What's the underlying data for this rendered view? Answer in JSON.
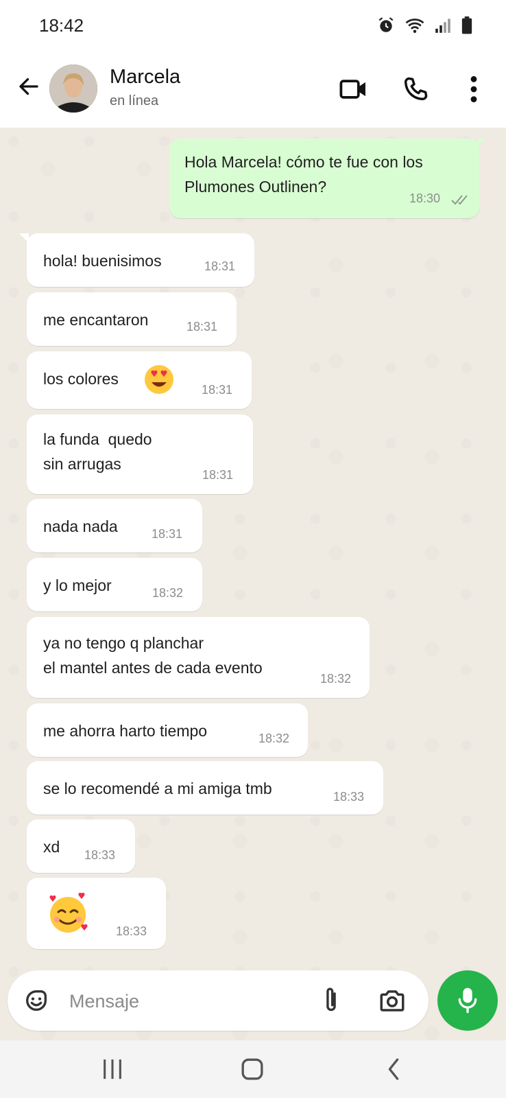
{
  "status_bar": {
    "time": "18:42",
    "icons": [
      "alarm-icon",
      "wifi-icon",
      "signal-icon",
      "battery-icon"
    ]
  },
  "header": {
    "contact_name": "Marcela",
    "contact_status": "en línea",
    "icons": [
      "back-arrow-icon",
      "video-call-icon",
      "phone-icon",
      "more-vert-icon"
    ]
  },
  "messages": [
    {
      "direction": "outgoing",
      "text": "Hola Marcela! cómo te fue con los\nPlumones Outlinen?",
      "time": "18:30",
      "status": "read"
    },
    {
      "direction": "incoming",
      "text": "hola! buenisimos",
      "time": "18:31"
    },
    {
      "direction": "incoming",
      "text": "me encantaron",
      "time": "18:31"
    },
    {
      "direction": "incoming",
      "text": "los colores",
      "emoji": "heart-eyes-emoji",
      "time": "18:31"
    },
    {
      "direction": "incoming",
      "text": "la funda  quedo\nsin arrugas",
      "time": "18:31"
    },
    {
      "direction": "incoming",
      "text": "nada nada",
      "time": "18:31"
    },
    {
      "direction": "incoming",
      "text": "y lo mejor",
      "time": "18:32"
    },
    {
      "direction": "incoming",
      "text": "ya no tengo q planchar\nel mantel antes de cada evento",
      "time": "18:32"
    },
    {
      "direction": "incoming",
      "text": "me ahorra harto tiempo",
      "time": "18:32"
    },
    {
      "direction": "incoming",
      "text": "se lo recomendé a mi amiga tmb",
      "time": "18:33"
    },
    {
      "direction": "incoming",
      "text": "xd",
      "time": "18:33"
    },
    {
      "direction": "incoming",
      "text": "",
      "emoji": "smiling-face-with-hearts-emoji",
      "time": "18:33"
    }
  ],
  "composer": {
    "placeholder": "Mensaje",
    "icons": [
      "sticker-icon",
      "attach-icon",
      "camera-icon",
      "mic-icon"
    ]
  },
  "colors": {
    "outgoing_bubble": "#d9fdd3",
    "incoming_bubble": "#ffffff",
    "chat_background": "#efeae2",
    "mic_button": "#25b34b"
  }
}
